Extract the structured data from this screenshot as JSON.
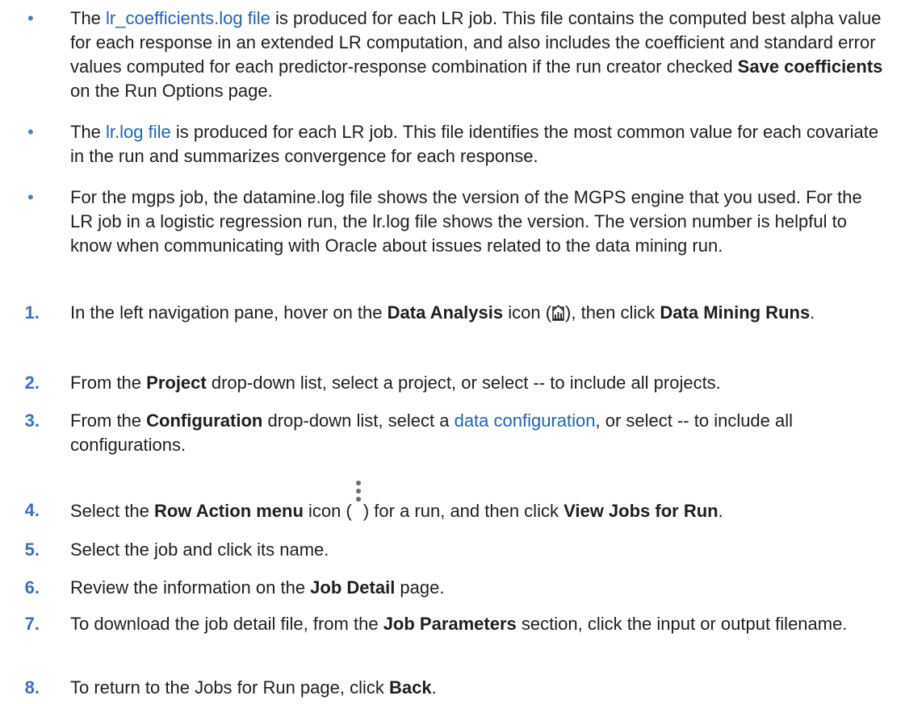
{
  "bullets": [
    {
      "pre": "The ",
      "link": "lr_coefficients.log file",
      "mid1": " is produced for each LR job. This file contains the computed best alpha value for each response in an extended LR computation, and also includes the coefficient and standard error values computed for each predictor-response combination if the run creator checked ",
      "bold": "Save coefficients",
      "post": " on the Run Options page."
    },
    {
      "pre": "The ",
      "link": "lr.log file",
      "post": " is produced for each LR job. This file identifies the most common value for each covariate in the run and summarizes convergence for each response."
    },
    {
      "text": "For the mgps job, the datamine.log file shows the version of the MGPS engine that you used. For the LR job in a logistic regression run, the lr.log file shows the version. The version number is helpful to know when communicating with Oracle about issues related to the data mining run."
    }
  ],
  "steps": [
    {
      "num": "1.",
      "t1": "In the left navigation pane, hover on the ",
      "b1": "Data Analysis",
      "t2": " icon (",
      "t3": "), then click ",
      "b2": "Data Mining Runs",
      "t4": "."
    },
    {
      "num": "2.",
      "t1": "From the ",
      "b1": "Project",
      "t2": " drop-down list, select a project, or select -- to include all projects."
    },
    {
      "num": "3.",
      "t1": "From the ",
      "b1": "Configuration",
      "t2": " drop-down list, select a ",
      "link": "data configuration",
      "t3": ", or select -- to include all configurations."
    },
    {
      "num": "4.",
      "t1": "Select the ",
      "b1": "Row Action menu",
      "t2": " icon (",
      "t3": ") for a run, and then click ",
      "b2": "View Jobs for Run",
      "t4": "."
    },
    {
      "num": "5.",
      "t1": "Select the job and click its name."
    },
    {
      "num": "6.",
      "t1": "Review the information on the ",
      "b1": "Job Detail",
      "t2": " page."
    },
    {
      "num": "7.",
      "t1": "To download the job detail file, from the ",
      "b1": "Job Parameters",
      "t2": " section, click the input or output filename."
    },
    {
      "num": "8.",
      "t1": "To return to the Jobs for Run page, click ",
      "b1": "Back",
      "t2": "."
    }
  ],
  "bullet_glyph": "•",
  "icons": {
    "data_analysis": "data-analysis-icon",
    "row_action": "kebab-menu-icon"
  },
  "colors": {
    "link": "#2463b3",
    "step_number": "#3d6fb6",
    "bullet": "#4f7fc1",
    "text": "#1f1f1f"
  }
}
